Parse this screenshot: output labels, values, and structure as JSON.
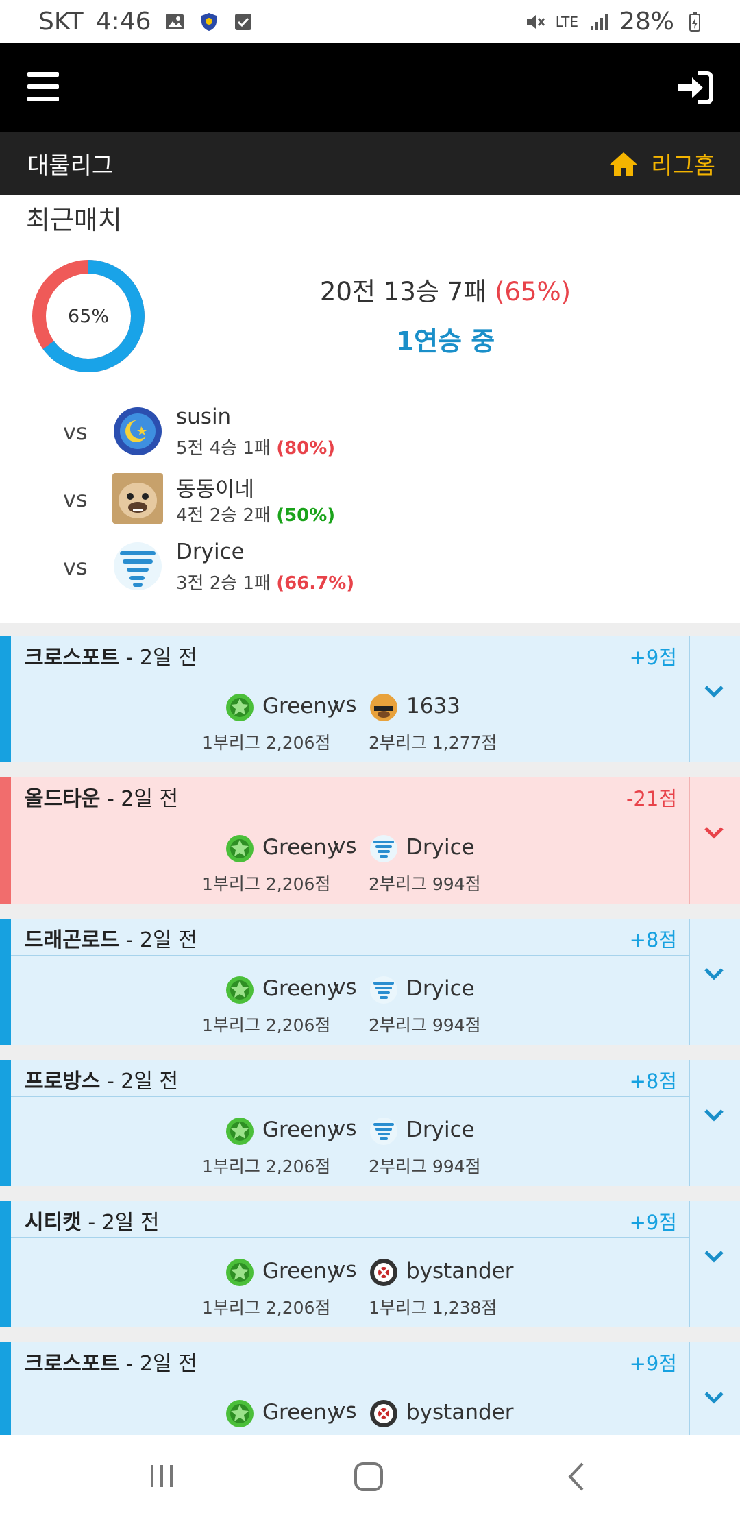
{
  "status": {
    "carrier": "SKT",
    "time": "4:46",
    "battery": "28%",
    "network": "LTE"
  },
  "header": {
    "menu_icon": "hamburger-icon",
    "login_icon": "sign-in-icon"
  },
  "league": {
    "title": "대룰리그",
    "home_label": "리그홈"
  },
  "recent": {
    "title": "최근매치",
    "win_pct_label": "65%",
    "win_fraction": 0.65,
    "record_text": "20전 13승 7패 ",
    "record_pct": "(65%)",
    "streak": "1연승 중"
  },
  "opponents": [
    {
      "vs": "vs",
      "name": "susin",
      "record": "5전 4승 1패 ",
      "pct": "(80%)",
      "pct_color": "red"
    },
    {
      "vs": "vs",
      "name": "동동이네",
      "record": "4전 2승 2패 ",
      "pct": "(50%)",
      "pct_color": "green"
    },
    {
      "vs": "vs",
      "name": "Dryice",
      "record": "3전 2승 1패 ",
      "pct": "(66.7%)",
      "pct_color": "red"
    }
  ],
  "matches": [
    {
      "result": "win",
      "map": "크로스포트",
      "ago": " - 2일 전",
      "points": "+9점",
      "p1": {
        "name": "Greeny",
        "score": "1부리그 2,206점"
      },
      "vs": "vs",
      "p2": {
        "name": "1633",
        "score": "2부리그 1,277점",
        "avatar": "bulldog"
      }
    },
    {
      "result": "loss",
      "map": "올드타운",
      "ago": " - 2일 전",
      "points": "-21점",
      "p1": {
        "name": "Greeny",
        "score": "1부리그 2,206점"
      },
      "vs": "vs",
      "p2": {
        "name": "Dryice",
        "score": "2부리그 994점",
        "avatar": "tornado"
      }
    },
    {
      "result": "win",
      "map": "드래곤로드",
      "ago": " - 2일 전",
      "points": "+8점",
      "p1": {
        "name": "Greeny",
        "score": "1부리그 2,206점"
      },
      "vs": "vs",
      "p2": {
        "name": "Dryice",
        "score": "2부리그 994점",
        "avatar": "tornado"
      }
    },
    {
      "result": "win",
      "map": "프로방스",
      "ago": " - 2일 전",
      "points": "+8점",
      "p1": {
        "name": "Greeny",
        "score": "1부리그 2,206점"
      },
      "vs": "vs",
      "p2": {
        "name": "Dryice",
        "score": "2부리그 994점",
        "avatar": "tornado"
      }
    },
    {
      "result": "win",
      "map": "시티캣",
      "ago": " - 2일 전",
      "points": "+9점",
      "p1": {
        "name": "Greeny",
        "score": "1부리그 2,206점"
      },
      "vs": "vs",
      "p2": {
        "name": "bystander",
        "score": "1부리그 1,238점",
        "avatar": "target"
      }
    },
    {
      "result": "win",
      "map": "크로스포트",
      "ago": " - 2일 전",
      "points": "+9점",
      "p1": {
        "name": "Greeny",
        "score": ""
      },
      "vs": "vs",
      "p2": {
        "name": "bystander",
        "score": "",
        "avatar": "target"
      }
    }
  ],
  "nav": {
    "recent_icon": "recent-apps-icon",
    "home_icon": "home-icon",
    "back_icon": "back-icon"
  }
}
